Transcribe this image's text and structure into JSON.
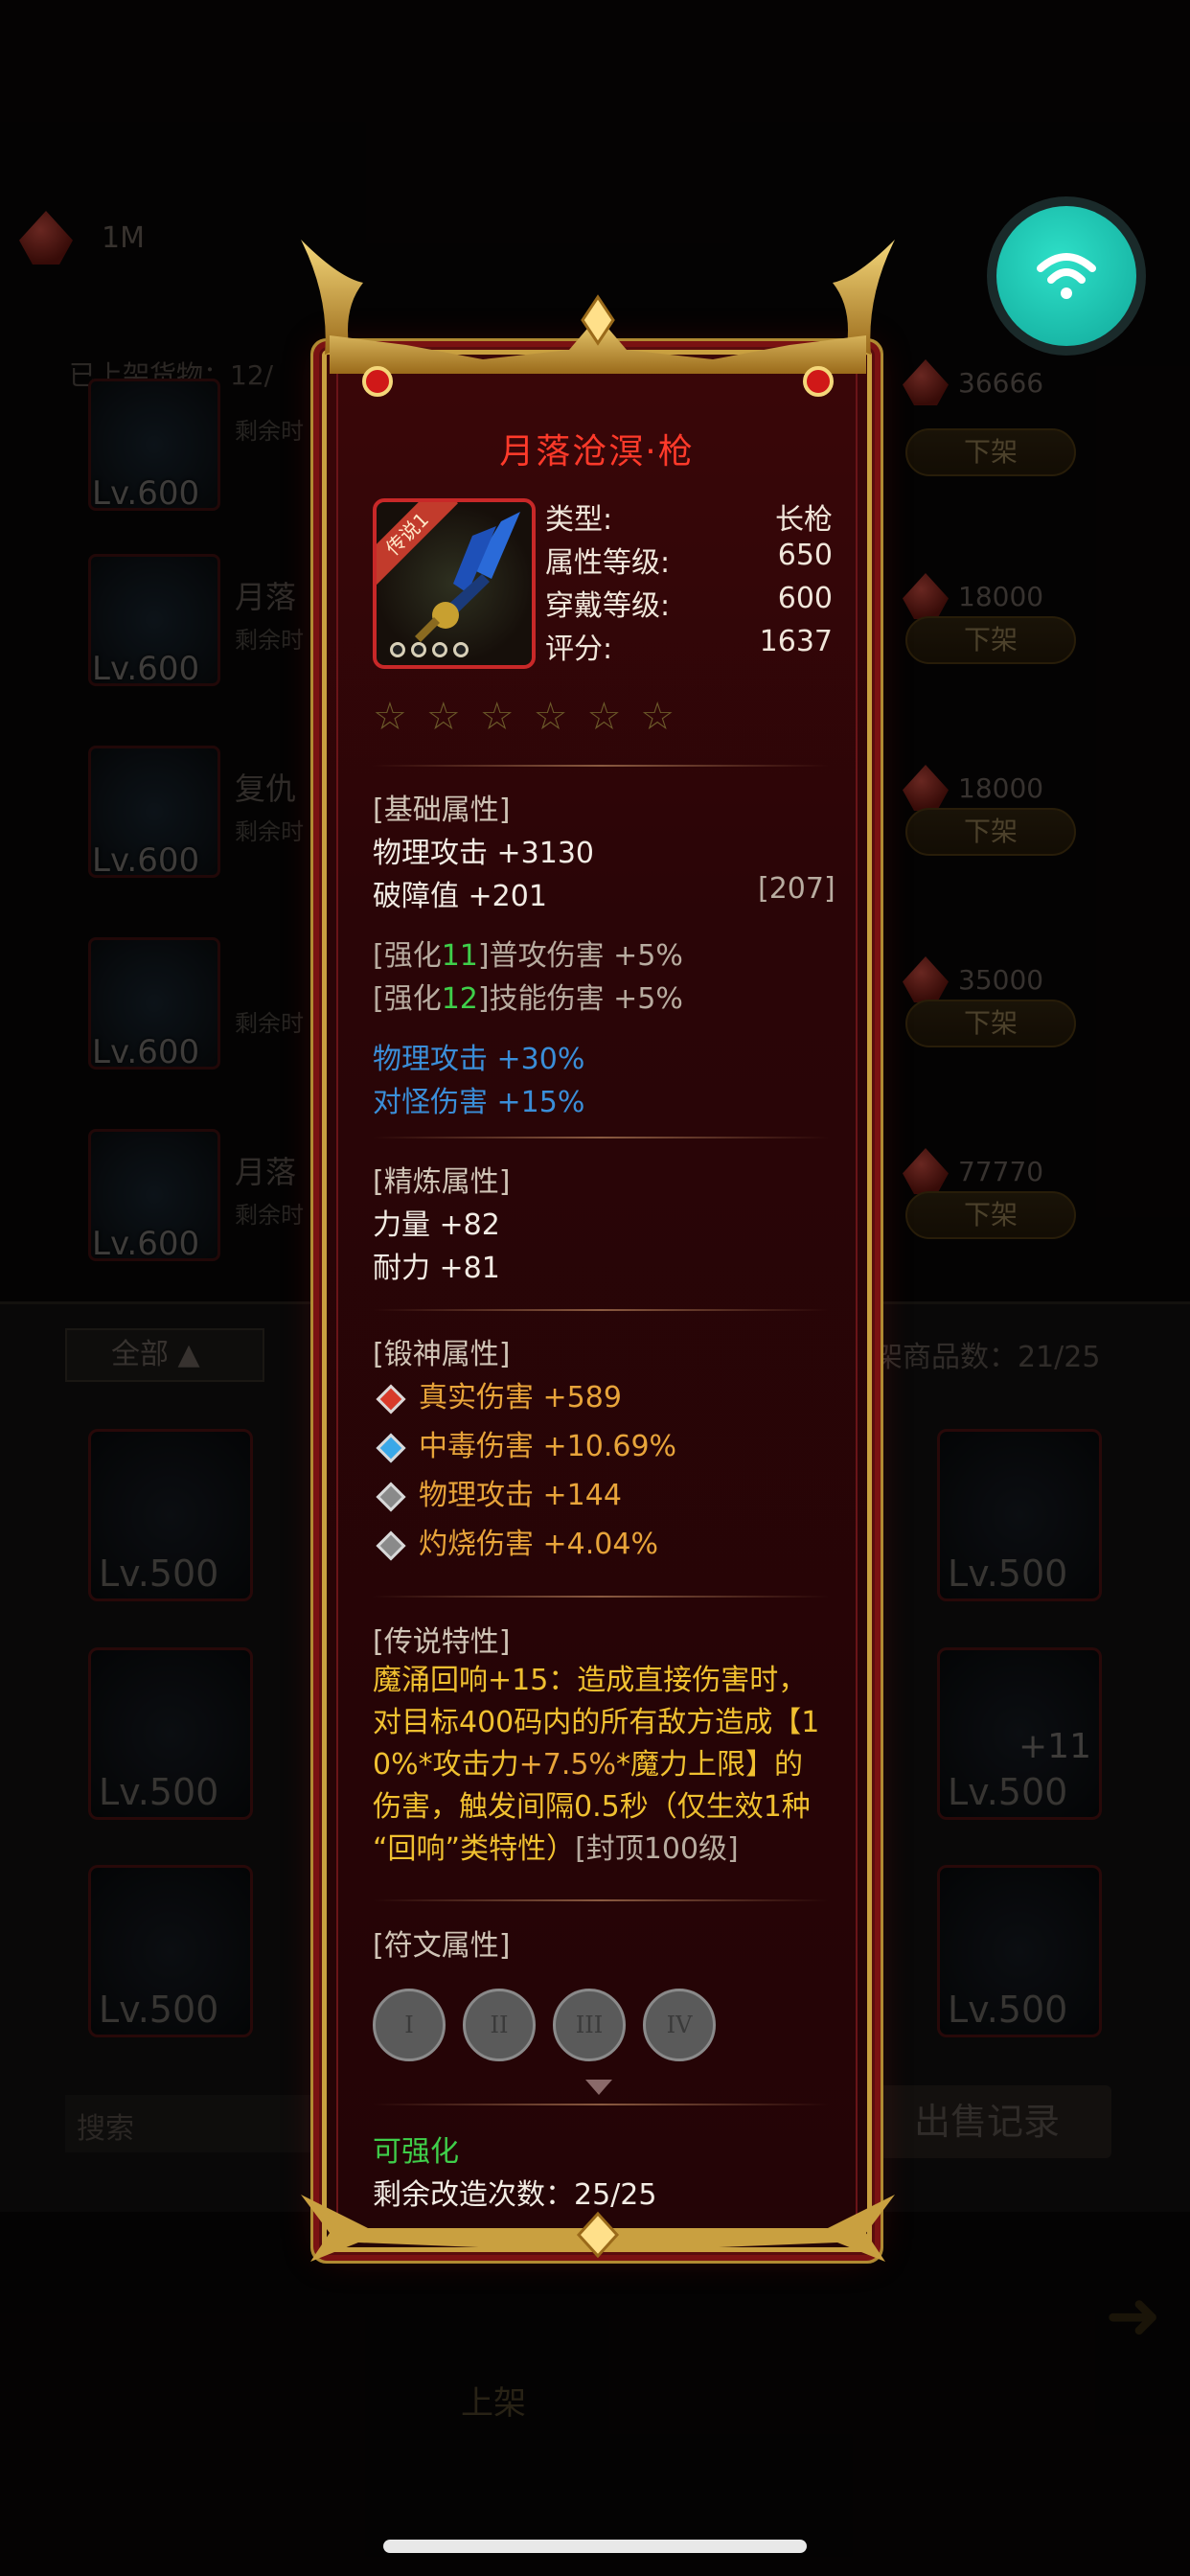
{
  "background": {
    "currency_amount": "1M",
    "shelf_count_label": "已上架货物：12/",
    "rows": [
      {
        "name": "",
        "remaining": "剩余时",
        "level": "Lv.600",
        "price": "36666",
        "down": "下架"
      },
      {
        "name": "月落",
        "remaining": "剩余时",
        "level": "Lv.600",
        "price": "18000",
        "down": "下架"
      },
      {
        "name": "复仇",
        "remaining": "剩余时",
        "level": "Lv.600",
        "price": "18000",
        "down": "下架"
      },
      {
        "name": "",
        "remaining": "剩余时",
        "level": "Lv.600",
        "price": "35000",
        "down": "下架"
      },
      {
        "name": "月落",
        "remaining": "剩余时",
        "level": "Lv.600",
        "price": "77770",
        "down": "下架"
      }
    ],
    "filter_label": "全部",
    "shelf_goods_label": "架商品数：21/25",
    "grid_levels": [
      "Lv.500",
      "Lv.500",
      "Lv.500",
      "Lv.500",
      "Lv.500",
      "Lv.500"
    ],
    "grid_badge": "+11",
    "search_placeholder": "搜索",
    "records_label": "出售记录",
    "nav_up_label": "上架"
  },
  "card": {
    "title": "月落沧溟·枪",
    "tag": "传说1",
    "info": [
      {
        "label": "类型:",
        "value": "长枪"
      },
      {
        "label": "属性等级:",
        "value": "650"
      },
      {
        "label": "穿戴等级:",
        "value": "600"
      },
      {
        "label": "评分:",
        "value": "1637"
      }
    ],
    "stars": 6,
    "basic": {
      "header": "[基础属性]",
      "lines": [
        "物理攻击 +3130",
        "破障值 +201"
      ],
      "extra": "[207]",
      "enh1_pre": "[强化",
      "enh1_num": "11",
      "enh1_post": "]普攻伤害 +5%",
      "enh2_pre": "[强化",
      "enh2_num": "12",
      "enh2_post": "]技能伤害 +5%",
      "blue1": "物理攻击 +30%",
      "blue2": "对怪伤害 +15%"
    },
    "refine": {
      "header": "[精炼属性]",
      "lines": [
        "力量 +82",
        "耐力 +81"
      ]
    },
    "forge": {
      "header": "[锻神属性]",
      "lines": [
        "真实伤害 +589",
        "中毒伤害 +10.69%",
        "物理攻击 +144",
        "灼烧伤害 +4.04%"
      ]
    },
    "legend": {
      "header": "[传说特性]",
      "l1": "魔涌回响+15：造成直接伤害时，",
      "l2": "对目标400码内的所有敌方造成【1",
      "l3a": "0%*攻击力",
      "l3b": "+7.5%",
      "l3c": "*魔力上限】的",
      "l4": "伤害，触发间隔0.5秒（仅生效1种",
      "l5a": "“回响”类特性）",
      "l5b": "[封顶100级]"
    },
    "rune": {
      "header": "[符文属性]",
      "slots": [
        "I",
        "II",
        "III",
        "IV"
      ]
    },
    "footer": {
      "upgradable": "可强化",
      "remaining": "剩余改造次数：25/25"
    }
  },
  "colors": {
    "title": "#ff3a2a",
    "frame_gold": "#c9a040",
    "green": "#3fcf4a",
    "blue": "#3a8ed8",
    "legend_gold": "#f0c030",
    "legend_orange": "#e8a43a",
    "wifi_teal": "#2ee0c8"
  }
}
